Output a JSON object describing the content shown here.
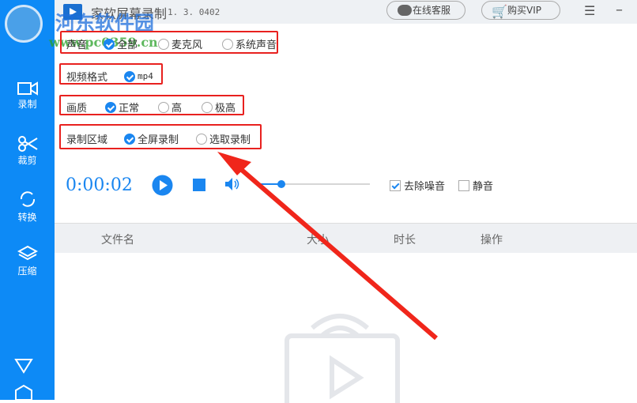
{
  "app": {
    "title": "家软屏幕录制",
    "version": "1. 3. 0402"
  },
  "header": {
    "service_label": "在线客服",
    "vip_label": "购买VIP"
  },
  "sidebar": {
    "items": [
      {
        "label": "录制"
      },
      {
        "label": "裁剪"
      },
      {
        "label": "转换"
      },
      {
        "label": "压缩"
      }
    ]
  },
  "settings": {
    "sound": {
      "label": "声音",
      "options": [
        "全部",
        "麦克风",
        "系统声音"
      ],
      "selected": 0
    },
    "format": {
      "label": "视频格式",
      "options": [
        "mp4"
      ],
      "selected": 0
    },
    "quality": {
      "label": "画质",
      "options": [
        "正常",
        "高",
        "极高"
      ],
      "selected": 0
    },
    "area": {
      "label": "录制区域",
      "options": [
        "全屏录制",
        "选取录制"
      ],
      "selected": 0
    }
  },
  "controls": {
    "timer": "0:00:02",
    "volume": 0.2,
    "denoise_label": "去除噪音",
    "denoise": true,
    "mute_label": "静音",
    "mute": false
  },
  "table": {
    "columns": [
      "文件名",
      "大小",
      "时长",
      "操作"
    ]
  },
  "watermark": {
    "name": "河东软件园",
    "url": "www.pc0359.cn"
  },
  "colors": {
    "accent": "#0d8af6",
    "highlight": "#e8211f"
  }
}
